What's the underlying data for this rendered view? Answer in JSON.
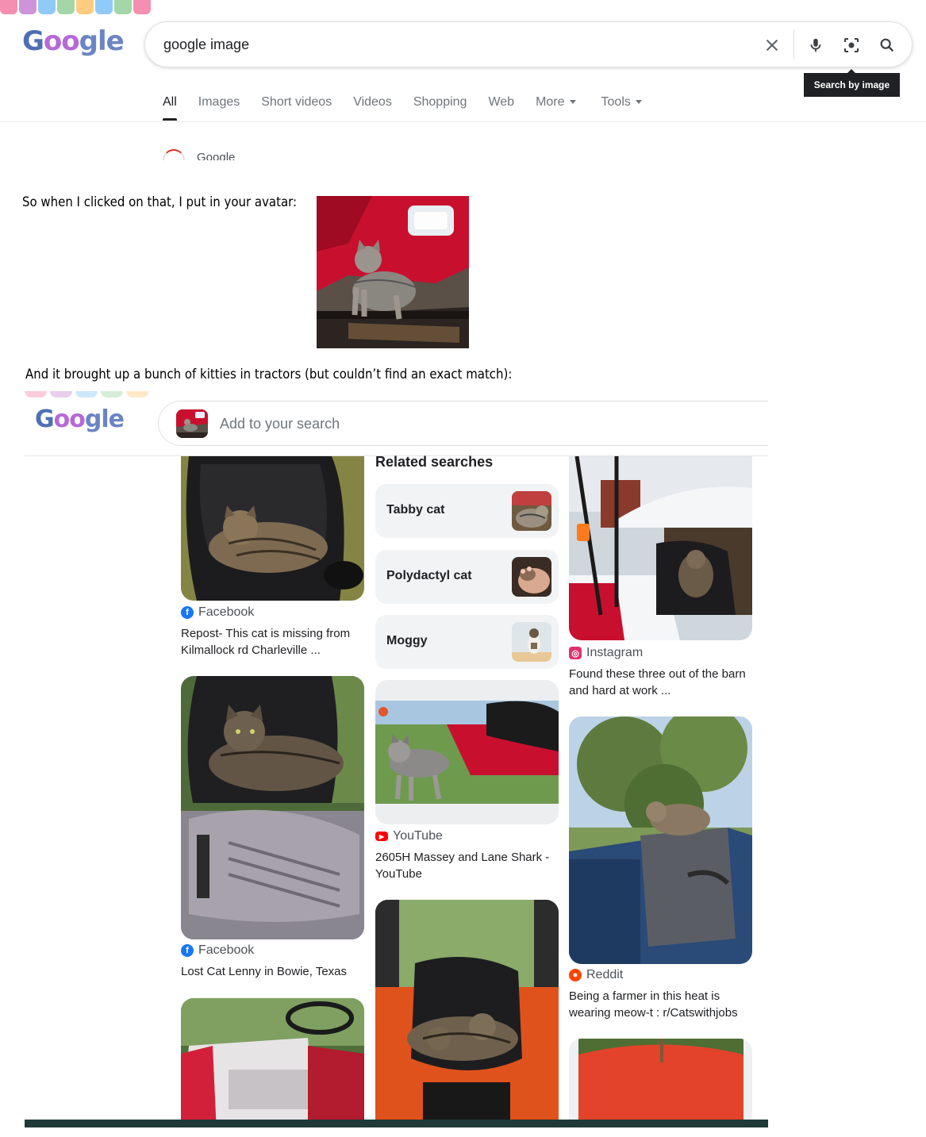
{
  "search": {
    "query": "google image",
    "tooltip": "Search by image"
  },
  "logo": {
    "g": "G",
    "oo": "oo",
    "rest": "gle"
  },
  "tabs": [
    {
      "label": "All"
    },
    {
      "label": "Images"
    },
    {
      "label": "Short videos"
    },
    {
      "label": "Videos"
    },
    {
      "label": "Shopping"
    },
    {
      "label": "Web"
    },
    {
      "label": "More"
    },
    {
      "label": "Tools"
    }
  ],
  "peek_result": "Google",
  "comments": {
    "first": "So when I clicked on that, I put in your avatar:",
    "second": "And it brought up a bunch of kitties in tractors (but couldn’t find an exact match):"
  },
  "lens": {
    "add_placeholder": "Add to your search",
    "related_heading": "Related searches",
    "related": [
      {
        "label": "Tabby cat"
      },
      {
        "label": "Polydactyl cat"
      },
      {
        "label": "Moggy"
      }
    ],
    "results": [
      {
        "source": "Facebook",
        "caption": "Repost- This cat is missing from Kilmallock rd Charleville ..."
      },
      {
        "source": "Facebook",
        "caption": "Lost Cat Lenny in Bowie, Texas"
      },
      {
        "source": "YouTube",
        "caption": "2605H Massey and Lane Shark - YouTube"
      },
      {
        "source": "Instagram",
        "caption": "Found these three out of the barn and hard at work ..."
      },
      {
        "source": "Reddit",
        "caption": "Being a farmer in this heat is wearing meow-t : r/Catswithjobs"
      }
    ]
  },
  "colors": {
    "facebook": "#1877f2",
    "youtube": "#ff0000",
    "instagram": "#e1306c",
    "reddit": "#ff4500"
  }
}
